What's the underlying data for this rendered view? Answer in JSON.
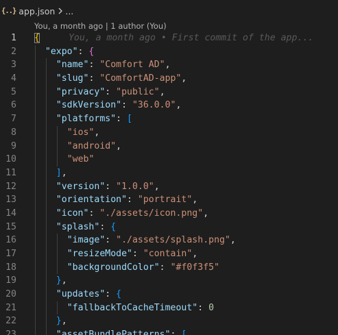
{
  "breadcrumb": {
    "file_icon": "{..}",
    "file_name": "app.json",
    "ellipsis": "..."
  },
  "blame": {
    "header": "You, a month ago | 1 author (You)",
    "inline": "You, a month ago • First commit of the app..."
  },
  "lines": [
    {
      "num": "1",
      "indent": 0,
      "tokens": [
        {
          "t": "{",
          "c": "b1 brace-match"
        }
      ],
      "ghost": true
    },
    {
      "num": "2",
      "indent": 1,
      "tokens": [
        {
          "t": "\"expo\"",
          "c": "k"
        },
        {
          "t": ": ",
          "c": "p"
        },
        {
          "t": "{",
          "c": "b2"
        }
      ]
    },
    {
      "num": "3",
      "indent": 2,
      "tokens": [
        {
          "t": "\"name\"",
          "c": "k"
        },
        {
          "t": ": ",
          "c": "p"
        },
        {
          "t": "\"Comfort AD\"",
          "c": "s"
        },
        {
          "t": ",",
          "c": "p"
        }
      ]
    },
    {
      "num": "4",
      "indent": 2,
      "tokens": [
        {
          "t": "\"slug\"",
          "c": "k"
        },
        {
          "t": ": ",
          "c": "p"
        },
        {
          "t": "\"ComfortAD-app\"",
          "c": "s"
        },
        {
          "t": ",",
          "c": "p"
        }
      ]
    },
    {
      "num": "5",
      "indent": 2,
      "tokens": [
        {
          "t": "\"privacy\"",
          "c": "k"
        },
        {
          "t": ": ",
          "c": "p"
        },
        {
          "t": "\"public\"",
          "c": "s"
        },
        {
          "t": ",",
          "c": "p"
        }
      ]
    },
    {
      "num": "6",
      "indent": 2,
      "tokens": [
        {
          "t": "\"sdkVersion\"",
          "c": "k"
        },
        {
          "t": ": ",
          "c": "p"
        },
        {
          "t": "\"36.0.0\"",
          "c": "s"
        },
        {
          "t": ",",
          "c": "p"
        }
      ]
    },
    {
      "num": "7",
      "indent": 2,
      "tokens": [
        {
          "t": "\"platforms\"",
          "c": "k"
        },
        {
          "t": ": ",
          "c": "p"
        },
        {
          "t": "[",
          "c": "b3"
        }
      ]
    },
    {
      "num": "8",
      "indent": 3,
      "tokens": [
        {
          "t": "\"ios\"",
          "c": "s"
        },
        {
          "t": ",",
          "c": "p"
        }
      ]
    },
    {
      "num": "9",
      "indent": 3,
      "tokens": [
        {
          "t": "\"android\"",
          "c": "s"
        },
        {
          "t": ",",
          "c": "p"
        }
      ]
    },
    {
      "num": "10",
      "indent": 3,
      "tokens": [
        {
          "t": "\"web\"",
          "c": "s"
        }
      ]
    },
    {
      "num": "11",
      "indent": 2,
      "tokens": [
        {
          "t": "]",
          "c": "b3"
        },
        {
          "t": ",",
          "c": "p"
        }
      ]
    },
    {
      "num": "12",
      "indent": 2,
      "tokens": [
        {
          "t": "\"version\"",
          "c": "k"
        },
        {
          "t": ": ",
          "c": "p"
        },
        {
          "t": "\"1.0.0\"",
          "c": "s"
        },
        {
          "t": ",",
          "c": "p"
        }
      ]
    },
    {
      "num": "13",
      "indent": 2,
      "tokens": [
        {
          "t": "\"orientation\"",
          "c": "k"
        },
        {
          "t": ": ",
          "c": "p"
        },
        {
          "t": "\"portrait\"",
          "c": "s"
        },
        {
          "t": ",",
          "c": "p"
        }
      ]
    },
    {
      "num": "14",
      "indent": 2,
      "tokens": [
        {
          "t": "\"icon\"",
          "c": "k"
        },
        {
          "t": ": ",
          "c": "p"
        },
        {
          "t": "\"./assets/icon.png\"",
          "c": "s"
        },
        {
          "t": ",",
          "c": "p"
        }
      ]
    },
    {
      "num": "15",
      "indent": 2,
      "tokens": [
        {
          "t": "\"splash\"",
          "c": "k"
        },
        {
          "t": ": ",
          "c": "p"
        },
        {
          "t": "{",
          "c": "b3"
        }
      ]
    },
    {
      "num": "16",
      "indent": 3,
      "tokens": [
        {
          "t": "\"image\"",
          "c": "k"
        },
        {
          "t": ": ",
          "c": "p"
        },
        {
          "t": "\"./assets/splash.png\"",
          "c": "s"
        },
        {
          "t": ",",
          "c": "p"
        }
      ]
    },
    {
      "num": "17",
      "indent": 3,
      "tokens": [
        {
          "t": "\"resizeMode\"",
          "c": "k"
        },
        {
          "t": ": ",
          "c": "p"
        },
        {
          "t": "\"contain\"",
          "c": "s"
        },
        {
          "t": ",",
          "c": "p"
        }
      ]
    },
    {
      "num": "18",
      "indent": 3,
      "tokens": [
        {
          "t": "\"backgroundColor\"",
          "c": "k"
        },
        {
          "t": ": ",
          "c": "p"
        },
        {
          "t": "\"#f0f3f5\"",
          "c": "s"
        }
      ]
    },
    {
      "num": "19",
      "indent": 2,
      "tokens": [
        {
          "t": "}",
          "c": "b3"
        },
        {
          "t": ",",
          "c": "p"
        }
      ]
    },
    {
      "num": "20",
      "indent": 2,
      "tokens": [
        {
          "t": "\"updates\"",
          "c": "k"
        },
        {
          "t": ": ",
          "c": "p"
        },
        {
          "t": "{",
          "c": "b3"
        }
      ]
    },
    {
      "num": "21",
      "indent": 3,
      "tokens": [
        {
          "t": "\"fallbackToCacheTimeout\"",
          "c": "k"
        },
        {
          "t": ": ",
          "c": "p"
        },
        {
          "t": "0",
          "c": "n"
        }
      ]
    },
    {
      "num": "22",
      "indent": 2,
      "tokens": [
        {
          "t": "}",
          "c": "b3"
        },
        {
          "t": ",",
          "c": "p"
        }
      ]
    },
    {
      "num": "23",
      "indent": 2,
      "tokens": [
        {
          "t": "\"assetBundlePatterns\"",
          "c": "k"
        },
        {
          "t": ": ",
          "c": "p"
        },
        {
          "t": "[",
          "c": "b3"
        }
      ]
    }
  ]
}
